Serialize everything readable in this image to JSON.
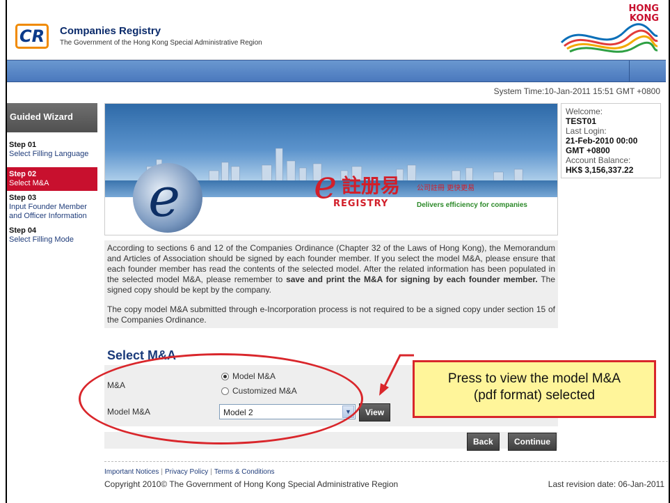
{
  "header": {
    "logo_text": "CR",
    "title": "Companies Registry",
    "subtitle": "The Government of the Hong Kong Special Administrative Region",
    "hk_logo_line1": "HONG",
    "hk_logo_line2": "KONG"
  },
  "system_time": "System Time:10-Jan-2011 15:51 GMT +0800",
  "wizard": {
    "title": "Guided Wizard",
    "steps": [
      {
        "num": "Step 01",
        "label": "Select Filling Language",
        "active": false
      },
      {
        "num": "Step 02",
        "label": "Select M&A",
        "active": true
      },
      {
        "num": "Step 03",
        "label": "Input Founder Member and Officer Information",
        "active": false
      },
      {
        "num": "Step 04",
        "label": "Select Filling Mode",
        "active": false
      }
    ]
  },
  "user": {
    "welcome_label": "Welcome:",
    "username": "TEST01",
    "last_login_label": "Last Login:",
    "last_login": "21-Feb-2010 00:00 GMT +0800",
    "balance_label": "Account Balance:",
    "balance": "HK$ 3,156,337.22"
  },
  "banner": {
    "cn_title": "註册易",
    "cn_sub": "公司註冊 更快更易",
    "en_title": "REGISTRY",
    "tagline": "Delivers efficiency for companies"
  },
  "content": {
    "para1_a": "According to sections 6 and 12 of the Companies Ordinance (Chapter 32 of the Laws of Hong Kong), the Memorandum and Articles of Association should be signed by each founder member. If you select the model M&A, please ensure that each founder member has read the contents of the selected model. After the related information has been populated in the selected model M&A, please remember to ",
    "para1_bold": "save and print the M&A for signing by each founder member.",
    "para1_c": " The signed copy should be kept by the company.",
    "para2": "The copy model M&A submitted through e-Incorporation process is not required to be a signed copy under section 15 of the Companies Ordinance."
  },
  "form": {
    "section_title": "Select M&A",
    "ma_label": "M&A",
    "option_model": "Model M&A",
    "option_custom": "Customized M&A",
    "selected_option": "Model M&A",
    "model_label": "Model M&A",
    "model_value": "Model 2",
    "view_label": "View",
    "back_label": "Back",
    "continue_label": "Continue"
  },
  "callout": {
    "line1": "Press to view the model M&A",
    "line2": "(pdf format) selected"
  },
  "footer": {
    "links": [
      "Important Notices",
      "Privacy Policy",
      "Terms & Conditions"
    ],
    "copyright": "Copyright 2010© The Government of Hong Kong Special Administrative Region",
    "revision": "Last revision date: 06-Jan-2011"
  },
  "colors": {
    "accent_red": "#c8102e",
    "callout_bg": "#fff59a",
    "title_blue": "#1a3a7a"
  }
}
